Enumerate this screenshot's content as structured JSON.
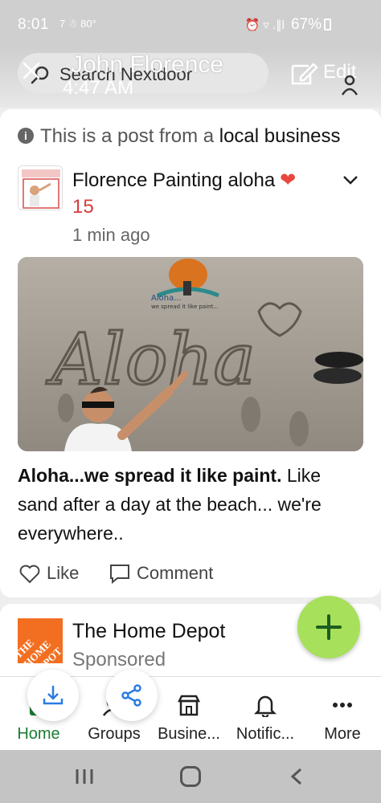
{
  "status_bar": {
    "time": "8:01",
    "left_icons": "7 ☃ 80°",
    "right_icons": "⏰ ▿ .∥l",
    "battery": "67%"
  },
  "header": {
    "search_placeholder": "Search Nextdoor",
    "overlay_name": "John Florence",
    "overlay_time": "4:47 AM",
    "edit_label": "Edit"
  },
  "post": {
    "notice_prefix": "This is a post from a ",
    "notice_bold": "local business",
    "author": "Florence Painting aloha",
    "count": "15",
    "time": "1 min ago",
    "photo_text_script": "Aloha",
    "photo_logo_text": "Aloha...",
    "photo_logo_sub": "we spread it like paint...",
    "caption_lead": "Aloha...we spread it like paint.",
    "caption_rest": " Like sand after a day at the beach... we're everywhere..",
    "like_label": "Like",
    "comment_label": "Comment"
  },
  "sponsored_post": {
    "title": "The Home Depot",
    "subtitle": "Sponsored",
    "logo_text": "THE HOME DEPOT"
  },
  "bottom_nav": {
    "items": [
      {
        "label": "Home"
      },
      {
        "label": "Groups"
      },
      {
        "label": "Busine..."
      },
      {
        "label": "Notific..."
      },
      {
        "label": "More"
      }
    ]
  },
  "colors": {
    "accent_green": "#1b7d34",
    "fab_green": "#a7e05a",
    "heart_red": "#e8473e",
    "count_red": "#d63b3b",
    "home_depot_orange": "#f26f21"
  }
}
